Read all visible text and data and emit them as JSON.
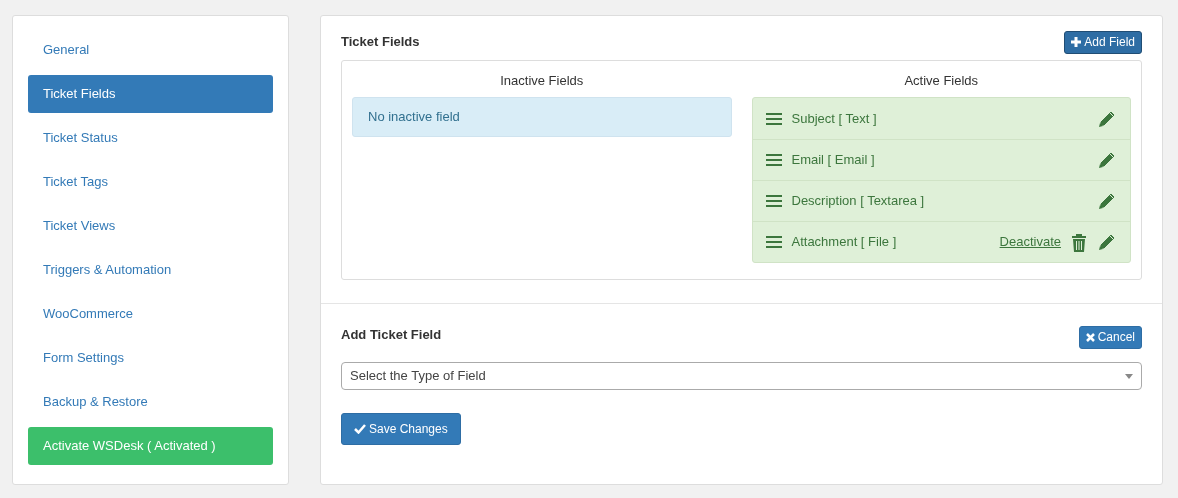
{
  "sidebar": {
    "items": [
      {
        "label": "General",
        "kind": "link",
        "selected": false
      },
      {
        "label": "Ticket Fields",
        "kind": "link",
        "selected": true
      },
      {
        "label": "Ticket Status",
        "kind": "link",
        "selected": false
      },
      {
        "label": "Ticket Tags",
        "kind": "link",
        "selected": false
      },
      {
        "label": "Ticket Views",
        "kind": "link",
        "selected": false
      },
      {
        "label": "Triggers & Automation",
        "kind": "link",
        "selected": false
      },
      {
        "label": "WooCommerce",
        "kind": "link",
        "selected": false
      },
      {
        "label": "Form Settings",
        "kind": "link",
        "selected": false
      },
      {
        "label": "Backup & Restore",
        "kind": "link",
        "selected": false
      },
      {
        "label": "Activate WSDesk ( Activated )",
        "kind": "activate",
        "selected": false
      }
    ]
  },
  "ticket_fields": {
    "title": "Ticket Fields",
    "add_button": "Add Field",
    "inactive": {
      "heading": "Inactive Fields",
      "empty_message": "No inactive field"
    },
    "active": {
      "heading": "Active Fields",
      "fields": [
        {
          "label": "Subject [ Text ]",
          "deletable": false
        },
        {
          "label": "Email [ Email ]",
          "deletable": false
        },
        {
          "label": "Description [ Textarea ]",
          "deletable": false
        },
        {
          "label": "Attachment [ File ]",
          "deactivate_link": "Deactivate",
          "deletable": true
        }
      ]
    }
  },
  "add_ticket_field": {
    "title": "Add Ticket Field",
    "cancel_button": "Cancel",
    "type_select": {
      "value": "Select the Type of Field"
    },
    "save_button": "Save Changes"
  }
}
